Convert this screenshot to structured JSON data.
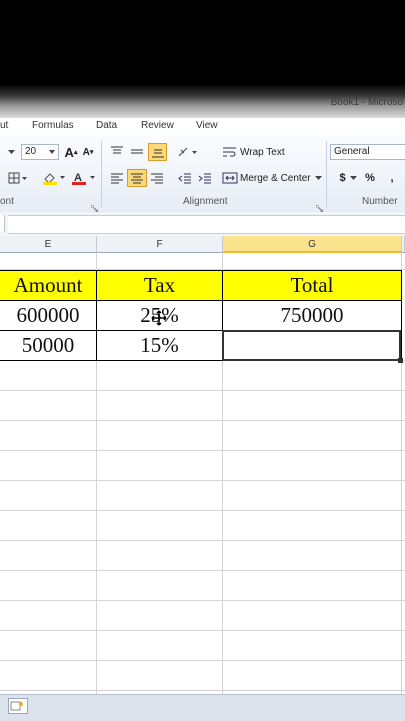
{
  "window": {
    "title": "Book1 - Microso"
  },
  "tabs": [
    "ut",
    "Formulas",
    "Data",
    "Review",
    "View"
  ],
  "ribbon": {
    "font_size": "20",
    "increase_font": "A",
    "decrease_font": "A",
    "wrap_text": "Wrap Text",
    "merge_center": "Merge & Center",
    "number_format": "General",
    "currency_symbol": "$",
    "percent_symbol": "%",
    "groups": {
      "font": "ont",
      "alignment": "Alignment",
      "number": "Number"
    }
  },
  "columns": [
    {
      "letter": "E",
      "selected": false
    },
    {
      "letter": "F",
      "selected": false
    },
    {
      "letter": "G",
      "selected": true
    }
  ],
  "table": {
    "headers": [
      "Amount",
      "Tax",
      "Total"
    ],
    "rows": [
      [
        "600000",
        "25%",
        "750000"
      ],
      [
        "50000",
        "15%",
        ""
      ]
    ],
    "header_color": "#ffff00"
  },
  "colors": {
    "accent_selected_col": "#fbe38e",
    "font_color_bar": "#e02020",
    "fill_color_bar": "#ffe000"
  }
}
